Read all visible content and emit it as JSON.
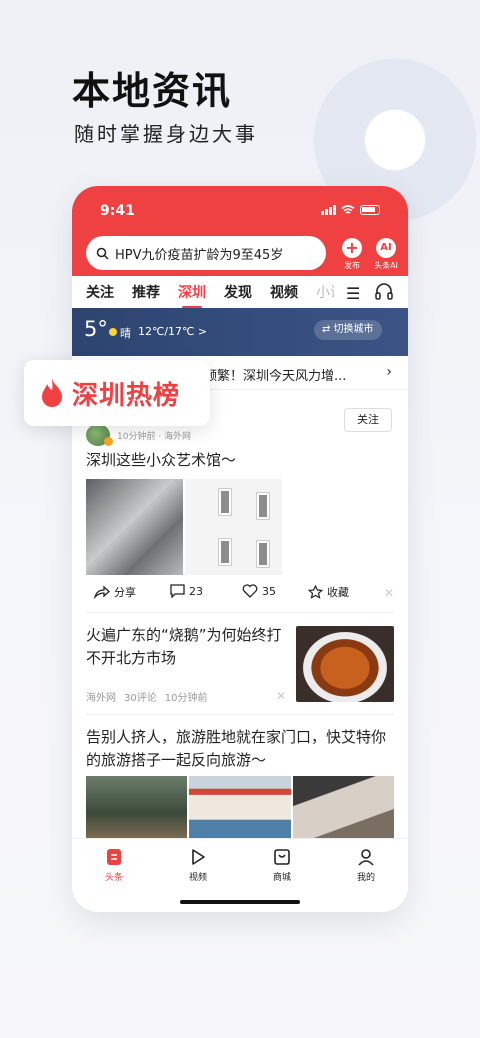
{
  "hero": {
    "title": "本地资讯",
    "subtitle": "随时掌握身边大事"
  },
  "status_bar": {
    "time": "9:41"
  },
  "search": {
    "query": "HPV九价疫苗扩龄为9至45岁"
  },
  "header_actions": {
    "publish_label": "发布",
    "publish_symbol": "+",
    "ai_label": "头条AI",
    "ai_symbol": "AI"
  },
  "tabs": [
    "关注",
    "推荐",
    "深圳",
    "发现",
    "视频",
    "小说"
  ],
  "active_tab": "深圳",
  "weather": {
    "temp": "5°",
    "desc": "晴",
    "range": "12℃/17℃ >",
    "switch_label": "⇄ 切换城市"
  },
  "hot_banner": {
    "badge_label": "深圳热榜",
    "text": "频繁！深圳今天风力增..."
  },
  "post": {
    "follow_label": "关注",
    "meta": "10分钟前 · 海外网",
    "title": "深圳这些小众艺术馆～",
    "share_label": "分享",
    "comments": "23",
    "likes": "35",
    "collect_label": "收藏"
  },
  "news2": {
    "title": "火遍广东的“烧鹅”为何始终打不开北方市场",
    "source": "海外网",
    "comments": "30评论",
    "time": "10分钟前"
  },
  "news3": {
    "title": "告别人挤人，旅游胜地就在家门口，快艾特你的旅游搭子一起反向旅游～"
  },
  "bottom_nav": [
    "头条",
    "视频",
    "商城",
    "我的"
  ],
  "colors": {
    "accent": "#f04142",
    "weather_bg": "#2d4470"
  }
}
